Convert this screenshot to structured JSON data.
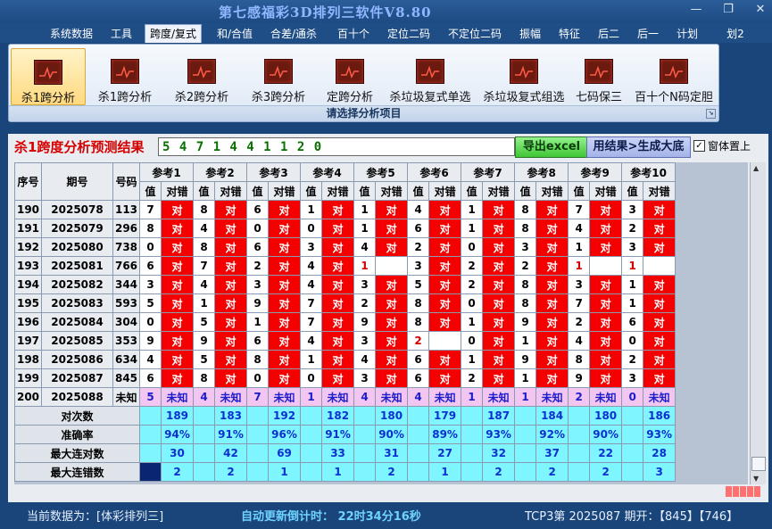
{
  "window": {
    "title": "第七感福彩3D排列三软件V8.80"
  },
  "menu": [
    "系统数据",
    "工具",
    "跨度/复式",
    "和/合值",
    "合差/通杀",
    "百十个",
    "定位二码",
    "不定位二码",
    "振幅",
    "特征",
    "后二",
    "后一",
    "计划",
    "划2"
  ],
  "menu_active_index": 2,
  "ribbon": {
    "buttons": [
      "杀1跨分析",
      "杀1跨分析",
      "杀2跨分析",
      "杀3跨分析",
      "定跨分析",
      "杀垃圾复式单选",
      "杀垃圾复式组选",
      "七码保三",
      "百十个N码定胆"
    ],
    "selected_index": 0,
    "footer": "请选择分析项目"
  },
  "result": {
    "title": "杀1跨度分析预测结果",
    "value": "5 4 7 1 4 4 1 1 2 0",
    "export_button": "导出excel",
    "generate_button": "用结果>生成大底",
    "ontop_label": "窗体置上",
    "ontop_checked": true
  },
  "table": {
    "fixed_headers": [
      "序号",
      "期号",
      "号码"
    ],
    "groups": [
      "参考1",
      "参考2",
      "参考3",
      "参考4",
      "参考5",
      "参考6",
      "参考7",
      "参考8",
      "参考9",
      "参考10"
    ],
    "sub_headers": [
      "值",
      "对错"
    ],
    "ok_text": "对",
    "rows": [
      {
        "seq": "190",
        "period": "2025078",
        "number": "113",
        "vals": [
          "7",
          "8",
          "6",
          "1",
          "1",
          "4",
          "1",
          "8",
          "7",
          "3"
        ],
        "res": [
          1,
          1,
          1,
          1,
          1,
          1,
          1,
          1,
          1,
          1
        ]
      },
      {
        "seq": "191",
        "period": "2025079",
        "number": "296",
        "vals": [
          "8",
          "4",
          "0",
          "0",
          "1",
          "6",
          "1",
          "8",
          "4",
          "2"
        ],
        "res": [
          1,
          1,
          1,
          1,
          1,
          1,
          1,
          1,
          1,
          1
        ]
      },
      {
        "seq": "192",
        "period": "2025080",
        "number": "738",
        "vals": [
          "0",
          "8",
          "6",
          "3",
          "4",
          "2",
          "0",
          "3",
          "1",
          "3"
        ],
        "res": [
          1,
          1,
          1,
          1,
          1,
          1,
          1,
          1,
          1,
          1
        ]
      },
      {
        "seq": "193",
        "period": "2025081",
        "number": "766",
        "vals": [
          "6",
          "7",
          "2",
          "4",
          "1",
          "3",
          "2",
          "2",
          "1",
          "1"
        ],
        "res": [
          1,
          1,
          1,
          1,
          0,
          1,
          1,
          1,
          0,
          0
        ]
      },
      {
        "seq": "194",
        "period": "2025082",
        "number": "344",
        "vals": [
          "3",
          "4",
          "3",
          "4",
          "3",
          "5",
          "2",
          "8",
          "3",
          "1"
        ],
        "res": [
          1,
          1,
          1,
          1,
          1,
          1,
          1,
          1,
          1,
          1
        ]
      },
      {
        "seq": "195",
        "period": "2025083",
        "number": "593",
        "vals": [
          "5",
          "1",
          "9",
          "7",
          "2",
          "8",
          "0",
          "8",
          "7",
          "1"
        ],
        "res": [
          1,
          1,
          1,
          1,
          1,
          1,
          1,
          1,
          1,
          1
        ]
      },
      {
        "seq": "196",
        "period": "2025084",
        "number": "304",
        "vals": [
          "0",
          "5",
          "1",
          "7",
          "9",
          "8",
          "1",
          "9",
          "2",
          "6"
        ],
        "res": [
          1,
          1,
          1,
          1,
          1,
          1,
          1,
          1,
          1,
          1
        ]
      },
      {
        "seq": "197",
        "period": "2025085",
        "number": "353",
        "vals": [
          "9",
          "9",
          "6",
          "4",
          "3",
          "2",
          "0",
          "1",
          "4",
          "0"
        ],
        "res": [
          1,
          1,
          1,
          1,
          1,
          0,
          1,
          1,
          1,
          1
        ]
      },
      {
        "seq": "198",
        "period": "2025086",
        "number": "634",
        "vals": [
          "4",
          "5",
          "8",
          "1",
          "4",
          "6",
          "1",
          "9",
          "8",
          "2"
        ],
        "res": [
          1,
          1,
          1,
          1,
          1,
          1,
          1,
          1,
          1,
          1
        ]
      },
      {
        "seq": "199",
        "period": "2025087",
        "number": "845",
        "vc": "",
        "vals": [
          "6",
          "8",
          "0",
          "0",
          "3",
          "6",
          "2",
          "1",
          "9",
          "3"
        ],
        "res": [
          1,
          1,
          1,
          1,
          1,
          1,
          1,
          1,
          1,
          1
        ]
      }
    ],
    "unknown_row": {
      "seq": "200",
      "period": "2025088",
      "number": "未知",
      "vals": [
        "5",
        "4",
        "7",
        "1",
        "4",
        "4",
        "1",
        "1",
        "2",
        "0"
      ],
      "res_text": "未知"
    },
    "stats": [
      {
        "label": "对次数",
        "vals": [
          "189",
          "183",
          "192",
          "182",
          "180",
          "179",
          "187",
          "184",
          "180",
          "186"
        ]
      },
      {
        "label": "准确率",
        "vals": [
          "94%",
          "91%",
          "96%",
          "91%",
          "90%",
          "89%",
          "93%",
          "92%",
          "90%",
          "93%"
        ]
      },
      {
        "label": "最大连对数",
        "vals": [
          "30",
          "42",
          "69",
          "33",
          "31",
          "27",
          "32",
          "37",
          "22",
          "28"
        ]
      },
      {
        "label": "最大连错数",
        "vals": [
          "2",
          "2",
          "1",
          "1",
          "2",
          "1",
          "2",
          "2",
          "2",
          "3"
        ]
      }
    ]
  },
  "statusbar": {
    "current_data": "当前数据为：[体彩排列三]",
    "countdown": "自动更新倒计时：  22时34分16秒",
    "draw": "TCP3第 2025087 期开：【845】【746】"
  }
}
